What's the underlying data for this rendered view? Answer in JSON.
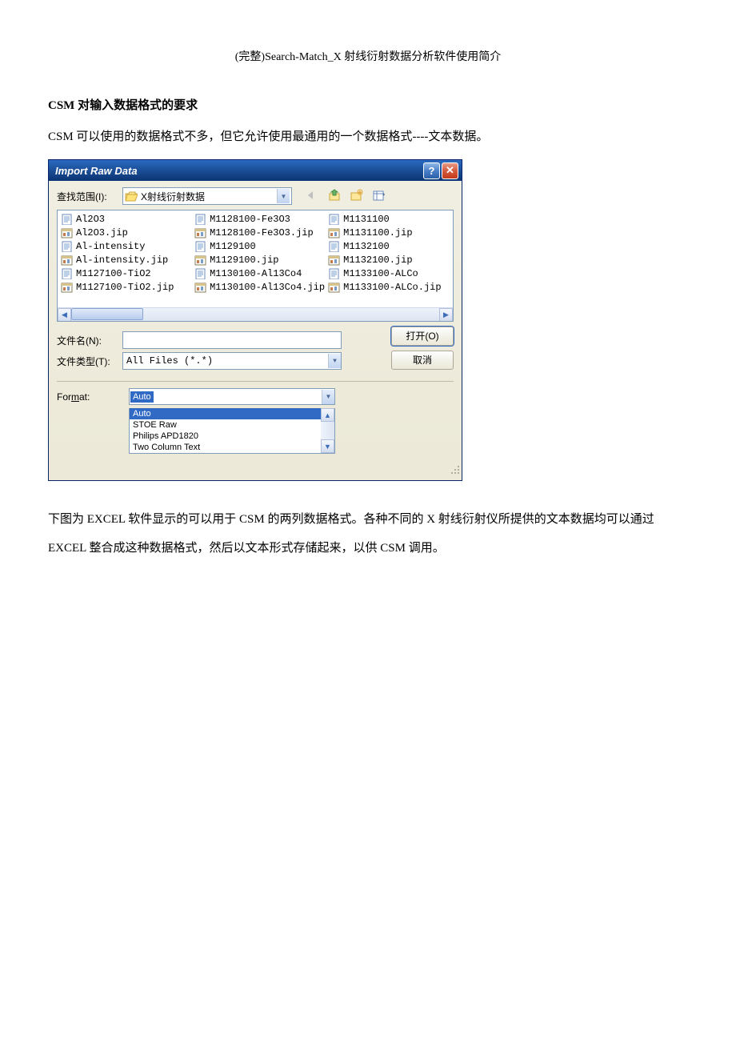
{
  "doc": {
    "title": "(完整)Search-Match_X 射线衍射数据分析软件使用简介",
    "heading": "CSM 对输入数据格式的要求",
    "para1": "CSM 可以使用的数据格式不多，但它允许使用最通用的一个数据格式----文本数据。",
    "para2": "下图为 EXCEL 软件显示的可以用于 CSM 的两列数据格式。各种不同的 X 射线衍射仪所提供的文本数据均可以通过 EXCEL 整合成这种数据格式，然后以文本形式存储起来，以供 CSM 调用。"
  },
  "dialog": {
    "title": "Import Raw Data",
    "lookin_label": "查找范围(I):",
    "folder": "X射线衍射数据",
    "files_col1": [
      {
        "name": "Al2O3",
        "type": "txt"
      },
      {
        "name": "Al2O3.jip",
        "type": "jip"
      },
      {
        "name": "Al-intensity",
        "type": "txt"
      },
      {
        "name": "Al-intensity.jip",
        "type": "jip"
      },
      {
        "name": "M1127100-TiO2",
        "type": "txt"
      },
      {
        "name": "M1127100-TiO2.jip",
        "type": "jip"
      }
    ],
    "files_col2": [
      {
        "name": "M1128100-Fe3O3",
        "type": "txt"
      },
      {
        "name": "M1128100-Fe3O3.jip",
        "type": "jip"
      },
      {
        "name": "M1129100",
        "type": "txt"
      },
      {
        "name": "M1129100.jip",
        "type": "jip"
      },
      {
        "name": "M1130100-Al13Co4",
        "type": "txt"
      },
      {
        "name": "M1130100-Al13Co4.jip",
        "type": "jip"
      }
    ],
    "files_col3": [
      {
        "name": "M1131100",
        "type": "txt"
      },
      {
        "name": "M1131100.jip",
        "type": "jip"
      },
      {
        "name": "M1132100",
        "type": "txt"
      },
      {
        "name": "M1132100.jip",
        "type": "jip"
      },
      {
        "name": "M1133100-ALCo",
        "type": "txt"
      },
      {
        "name": "M1133100-ALCo.jip",
        "type": "jip"
      }
    ],
    "filename_label": "文件名(N):",
    "filetype_label": "文件类型(T):",
    "filetype_value": "All Files (*.*)",
    "open_button": "打开(O)",
    "cancel_button": "取消",
    "format_label": "Format:",
    "format_selected": "Auto",
    "format_options": [
      "Auto",
      "STOE Raw",
      "Philips APD1820",
      "Two Column Text"
    ]
  }
}
